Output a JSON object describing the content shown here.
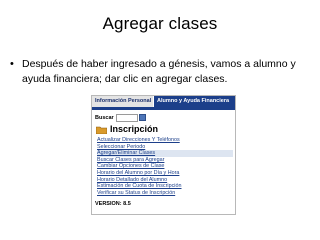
{
  "slide": {
    "title": "Agregar clases",
    "bullet": "•",
    "text": "Después de haber ingresado a génesis, vamos a alumno y ayuda financiera; dar clic en agregar clases."
  },
  "screenshot": {
    "tabs": [
      "Información Personal",
      "Alumno y Ayuda Financiera"
    ],
    "search": {
      "label": "Buscar",
      "value": "",
      "button_icon": "go-button-icon"
    },
    "section": {
      "icon": "folder-icon",
      "title": "Inscripción"
    },
    "menu": [
      "Actualizar Direcciones Y Teléfonos",
      "Seleccionar Periodo",
      "Agregar/Eliminar Clases",
      "Buscar Clases para Agregar",
      "Cambiar Opciones de Clase",
      "Horario del Alumno por Día y Hora",
      "Horario Detallado del Alumno",
      "Estimación de Cuota de Inscripción",
      "Verificar su Status de Inscripción"
    ],
    "active_item": "Agregar/Eliminar Clases",
    "version": "VERSION: 8.5"
  },
  "colors": {
    "nav_blue": "#1c3f8a",
    "tab_gray": "#e4e4e4",
    "link_blue": "#1c3f8a"
  }
}
